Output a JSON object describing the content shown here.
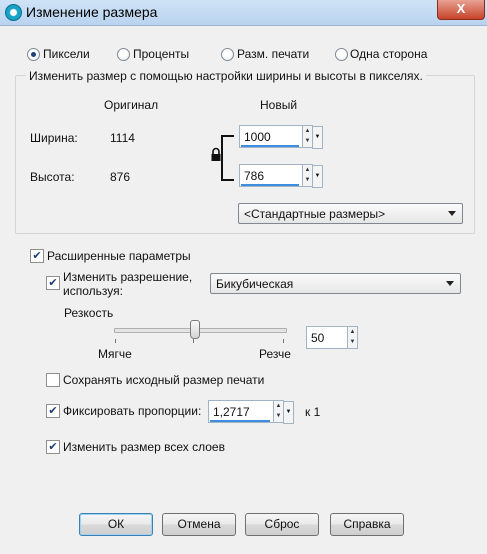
{
  "window": {
    "title": "Изменение размера",
    "close_glyph": "X"
  },
  "mode_options": [
    {
      "label": "Пиксели",
      "selected": true
    },
    {
      "label": "Проценты",
      "selected": false
    },
    {
      "label": "Разм. печати",
      "selected": false
    },
    {
      "label": "Одна сторона",
      "selected": false
    }
  ],
  "group": {
    "legend": "Изменить размер с помощью настройки ширины и высоты в пикселях.",
    "original_header": "Оригинал",
    "new_header": "Новый",
    "width_label": "Ширина:",
    "width_original": "1114",
    "width_new": "1000",
    "height_label": "Высота:",
    "height_original": "876",
    "height_new": "786",
    "lock_icon": "lock-icon",
    "preset_dropdown": "<Стандартные размеры>"
  },
  "advanced": {
    "checked": true,
    "label": "Расширенные параметры",
    "resample_checked": true,
    "resample_label": "Изменить разрешение, используя:",
    "resample_method": "Бикубическая",
    "sharpness_label": "Резкость",
    "softer_label": "Мягче",
    "sharper_label": "Резче",
    "sharpness_value": "50",
    "keep_print_size_checked": false,
    "keep_print_size_label": "Сохранять исходный размер печати",
    "lock_ratio_checked": true,
    "lock_ratio_label": "Фиксировать пропорции:",
    "ratio_value": "1,2717",
    "ratio_suffix": "к 1",
    "all_layers_checked": true,
    "all_layers_label": "Изменить размер всех слоев"
  },
  "buttons": {
    "ok": "ОК",
    "cancel": "Отмена",
    "reset": "Сброс",
    "help": "Справка"
  },
  "colors": {
    "accent_underline": "#3d8ee0",
    "close_button": "#c7442c"
  }
}
